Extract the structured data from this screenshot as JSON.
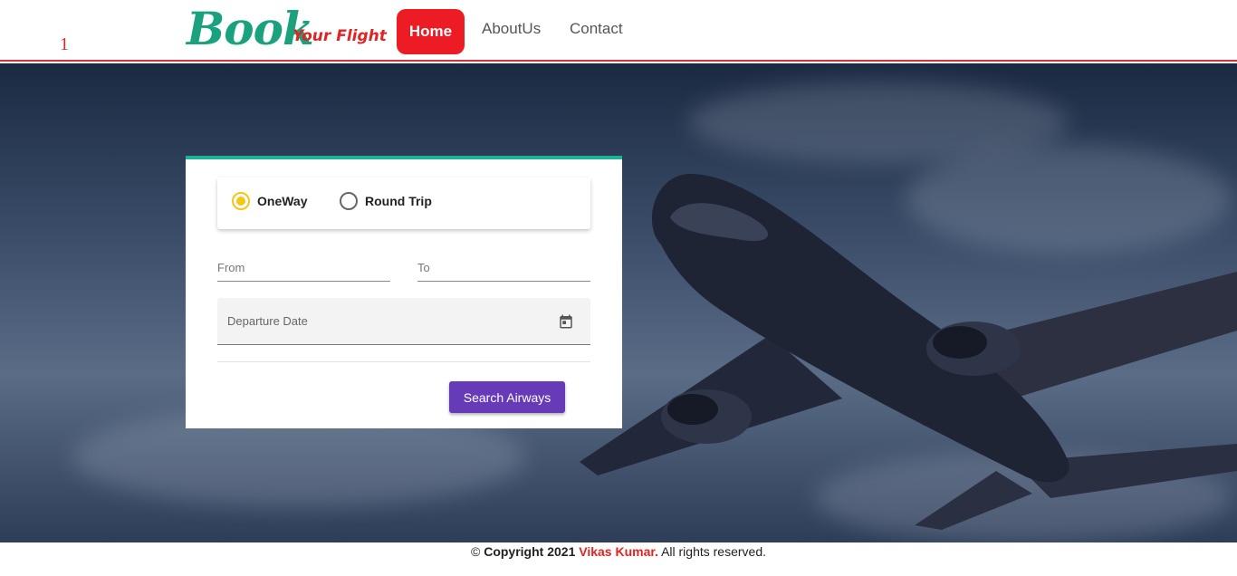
{
  "header": {
    "counter": "1",
    "brand_main": "Book",
    "brand_sub": "Your Flight",
    "nav": {
      "home": "Home",
      "about": "AboutUs",
      "contact": "Contact"
    }
  },
  "search_form": {
    "trip_type": {
      "oneway_label": "OneWay",
      "round_label": "Round Trip",
      "selected": "OneWay"
    },
    "from_label": "From",
    "to_label": "To",
    "departure_label": "Departure Date",
    "search_button": "Search Airways"
  },
  "footer": {
    "symbol": "©",
    "copyright": "Copyright 2021",
    "author": "Vikas Kumar.",
    "rights": "All rights reserved."
  },
  "colors": {
    "brand_green": "#1aa17d",
    "brand_red": "#e02424",
    "nav_active": "#ed1c24",
    "card_top_border": "#1ab394",
    "radio_selected": "#f5c518",
    "search_button": "#673ab7"
  },
  "icons": {
    "calendar": "calendar-icon"
  }
}
